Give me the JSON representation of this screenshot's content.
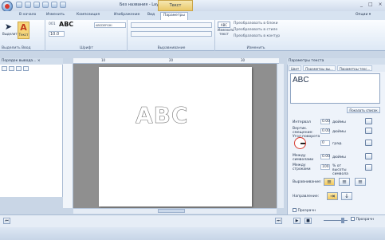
{
  "window": {
    "title": "Без названия - Layout It 6.1...",
    "context_tab": "Текст",
    "controls": [
      "_",
      "□",
      "×"
    ]
  },
  "menu": {
    "tabs": [
      "В начало",
      "Изменить",
      "Композиция",
      "Изображение",
      "Вид",
      "Параметры"
    ],
    "options": "Опции ▾"
  },
  "ribbon": {
    "selection": {
      "select_label": "Выделить",
      "text_label": "Текст",
      "group_label": "Выделить",
      "group2_label": "Ввод"
    },
    "font": {
      "name": "ABC",
      "preview": "ABCDEFGHI",
      "size": "10.0",
      "group_label": "Шрифт"
    },
    "alignment": {
      "group_label": "Выравнивание"
    },
    "change": {
      "label": "Изменить текст",
      "items": [
        "Преобразовать в блоки",
        "Преобразовать в стиле",
        "Преобразовать в контур"
      ],
      "group_label": "Изменить"
    }
  },
  "left_panel": {
    "title": "Порядок вывода... ⨯"
  },
  "canvas": {
    "ruler_marks": [
      "10",
      "20",
      "30"
    ],
    "text": "ABC"
  },
  "right_panel": {
    "title": "Параметры текста",
    "tabs": [
      "Цвет",
      "Параметры вы...",
      "Параметры текс..."
    ],
    "text_value": "ABC",
    "show_list": "Показать список",
    "interval": {
      "label": "Интервал",
      "value": "0.00",
      "unit": "дюймы"
    },
    "vertical_offset": {
      "label": "Вертик. смещение:",
      "value": "0.00",
      "unit": "дюймы"
    },
    "rotation": {
      "label": "Угол поворота",
      "value": "0",
      "unit": "град."
    },
    "char_spacing": {
      "label": "Между символами",
      "value": "0.00",
      "unit": "дюймы"
    },
    "line_spacing": {
      "label": "Между строками",
      "value": "100",
      "unit": "% от высоты символа"
    },
    "align_label": "Выравнивание:",
    "direction_label": "Направление:",
    "frame_label": "Прозрачн"
  },
  "bottom": {
    "transparency": "Прозрачн"
  }
}
